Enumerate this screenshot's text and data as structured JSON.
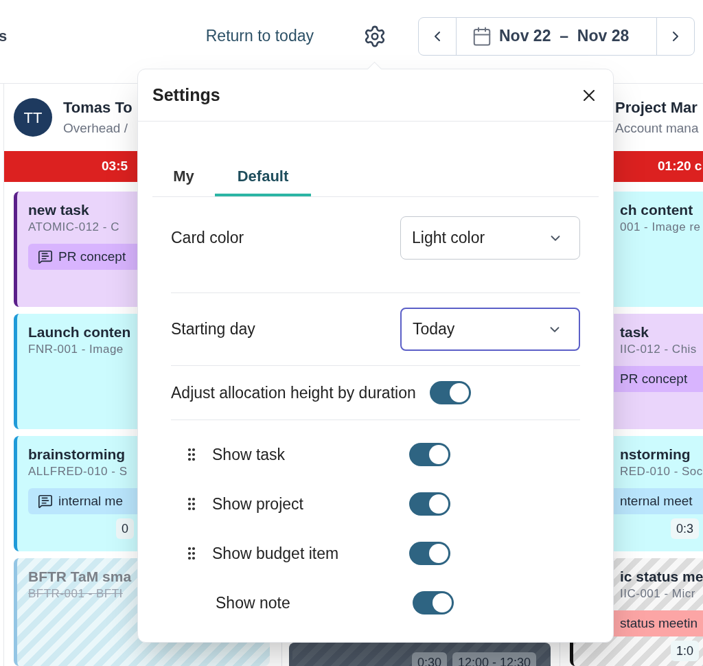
{
  "top_bar": {
    "cut_label": "s",
    "return_link": "Return to today",
    "date_range": {
      "start": "Nov 22",
      "separator": "–",
      "end": "Nov 28"
    }
  },
  "columns": [
    {
      "name": "Tomas To",
      "subtitle": "Overhead /",
      "initials": "TT",
      "total": "03:5",
      "cards": [
        {
          "kind": "solid",
          "color": "#ead5fb",
          "title": "new task",
          "code": "ATOMIC-012 - C",
          "struck": false,
          "tag": {
            "text": "PR concept",
            "color": "#d8b4fe",
            "icon": true
          }
        },
        {
          "kind": "solid",
          "color": "#ccfbfe",
          "title": "Launch conten",
          "code": "FNR-001 - Image",
          "struck": false
        },
        {
          "kind": "solid",
          "color": "#ccfbfe",
          "title": "brainstorming",
          "code": "ALLFRED-010 - S",
          "struck": false,
          "tag": {
            "text": "internal me",
            "color": "#bae6fd",
            "icon": true
          },
          "badges": [
            "0"
          ]
        },
        {
          "kind": "striped",
          "color": "#93c5e4",
          "title": "BFTR TaM sma",
          "code": "BFTR-001 - BFTI",
          "struck": true
        }
      ]
    },
    {
      "cards": [
        {
          "kind": "dark",
          "badges": [
            "0:30",
            "12:00 - 12:30"
          ]
        }
      ]
    },
    {
      "name": "Project Mar",
      "subtitle": "Account mana",
      "total": "01:20 c",
      "cards": [
        {
          "kind": "solid",
          "color": "#ccfbfe",
          "title": "ch content",
          "code": "001 - Image re",
          "struck": false
        },
        {
          "kind": "solid",
          "color": "#ead5fb",
          "title": "task",
          "code": "IIC-012 - Chis",
          "struck": false,
          "tag": {
            "text": "PR concept",
            "color": "#d8b4fe",
            "icon": false
          }
        },
        {
          "kind": "solid",
          "color": "#ccfbfe",
          "title": "nstorming",
          "code": "RED-010 - Soc",
          "struck": false,
          "tag": {
            "text": "nternal meet",
            "color": "#bae6fd",
            "icon": false
          },
          "badges": [
            "0:3"
          ]
        },
        {
          "kind": "striped",
          "color": "#111111",
          "title": "ic status me",
          "code": "IIC-001 - Micr",
          "struck": false,
          "tag": {
            "text": "status meetin",
            "color": "#fca5a5",
            "icon": false
          },
          "badges": [
            "1:0"
          ]
        }
      ]
    }
  ],
  "settings": {
    "title": "Settings",
    "tabs": [
      {
        "label": "My",
        "selected": false
      },
      {
        "label": "Default",
        "selected": true
      }
    ],
    "selects": [
      {
        "label": "Card color",
        "value": "Light color",
        "focused": false
      },
      {
        "label": "Starting day",
        "value": "Today",
        "focused": true
      }
    ],
    "adjust": {
      "label": "Adjust allocation height by duration",
      "on": true
    },
    "fields": [
      {
        "label": "Show task",
        "on": true,
        "draggable": true
      },
      {
        "label": "Show project",
        "on": true,
        "draggable": true
      },
      {
        "label": "Show budget item",
        "on": true,
        "draggable": true
      },
      {
        "label": "Show note",
        "on": true,
        "draggable": false
      }
    ]
  }
}
